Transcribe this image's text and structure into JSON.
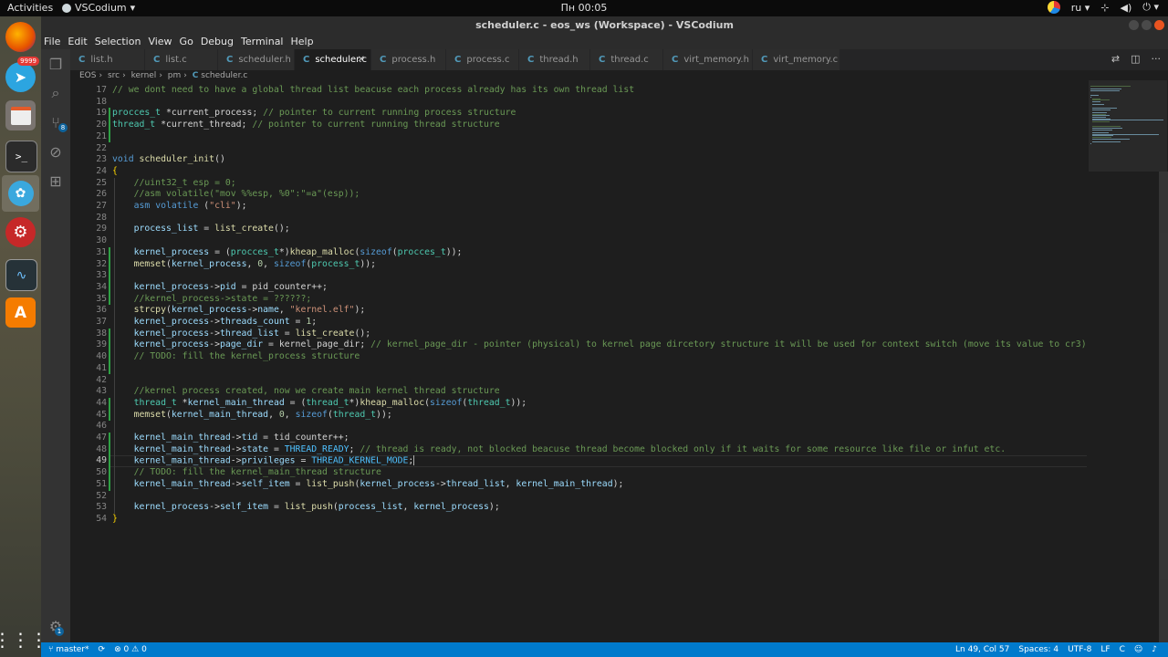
{
  "topbar": {
    "activities": "Activities",
    "app_name": "VSCodium",
    "clock": "Пн 00:05",
    "keyboard_layout": "ru"
  },
  "dock": {
    "telegram_badge": "9999"
  },
  "window": {
    "title": "scheduler.c - eos_ws (Workspace) - VSCodium"
  },
  "menu": [
    "File",
    "Edit",
    "Selection",
    "View",
    "Go",
    "Debug",
    "Terminal",
    "Help"
  ],
  "activity_bar": {
    "scm_badge": "8",
    "manage_badge": "1"
  },
  "tabs": [
    {
      "label": "list.h",
      "active": false
    },
    {
      "label": "list.c",
      "active": false
    },
    {
      "label": "scheduler.h",
      "active": false
    },
    {
      "label": "scheduler.c",
      "active": true
    },
    {
      "label": "process.h",
      "active": false
    },
    {
      "label": "process.c",
      "active": false
    },
    {
      "label": "thread.h",
      "active": false
    },
    {
      "label": "thread.c",
      "active": false
    },
    {
      "label": "virt_memory.h",
      "active": false
    },
    {
      "label": "virt_memory.c",
      "active": false
    }
  ],
  "breadcrumb": [
    "EOS",
    "src",
    "kernel",
    "pm",
    "scheduler.c"
  ],
  "editor": {
    "language": "c",
    "current_line": 49,
    "lines": [
      {
        "n": 17,
        "t": "// we dont need to have a global thread list beacuse each process already has its own thread list"
      },
      {
        "n": 18,
        "t": ""
      },
      {
        "n": 19,
        "t": "procces_t *current_process; // pointer to current running process structure"
      },
      {
        "n": 20,
        "t": "thread_t *current_thread; // pointer to current running thread structure"
      },
      {
        "n": 21,
        "t": ""
      },
      {
        "n": 22,
        "t": ""
      },
      {
        "n": 23,
        "t": "void scheduler_init()"
      },
      {
        "n": 24,
        "t": "{"
      },
      {
        "n": 25,
        "t": "    //uint32_t esp = 0;"
      },
      {
        "n": 26,
        "t": "    //asm volatile(\"mov %%esp, %0\":\"=a\"(esp));"
      },
      {
        "n": 27,
        "t": "    asm volatile (\"cli\");"
      },
      {
        "n": 28,
        "t": ""
      },
      {
        "n": 29,
        "t": "    process_list = list_create();"
      },
      {
        "n": 30,
        "t": ""
      },
      {
        "n": 31,
        "t": "    kernel_process = (procces_t*)kheap_malloc(sizeof(procces_t));"
      },
      {
        "n": 32,
        "t": "    memset(kernel_process, 0, sizeof(process_t));"
      },
      {
        "n": 33,
        "t": ""
      },
      {
        "n": 34,
        "t": "    kernel_process->pid = pid_counter++;"
      },
      {
        "n": 35,
        "t": "    //kernel_process->state = ??????;"
      },
      {
        "n": 36,
        "t": "    strcpy(kernel_process->name, \"kernel.elf\");"
      },
      {
        "n": 37,
        "t": "    kernel_process->threads_count = 1;"
      },
      {
        "n": 38,
        "t": "    kernel_process->thread_list = list_create();"
      },
      {
        "n": 39,
        "t": "    kernel_process->page_dir = kernel_page_dir; // kernel_page_dir - pointer (physical) to kernel page dircetory structure it will be used for context switch (move its value to cr3)"
      },
      {
        "n": 40,
        "t": "    // TODO: fill the kernel_process structure"
      },
      {
        "n": 41,
        "t": ""
      },
      {
        "n": 42,
        "t": ""
      },
      {
        "n": 43,
        "t": "    //kernel process created, now we create main kernel thread structure"
      },
      {
        "n": 44,
        "t": "    thread_t *kernel_main_thread = (thread_t*)kheap_malloc(sizeof(thread_t));"
      },
      {
        "n": 45,
        "t": "    memset(kernel_main_thread, 0, sizeof(thread_t));"
      },
      {
        "n": 46,
        "t": ""
      },
      {
        "n": 47,
        "t": "    kernel_main_thread->tid = tid_counter++;"
      },
      {
        "n": 48,
        "t": "    kernel_main_thread->state = THREAD_READY; // thread is ready, not blocked beacuse thread become blocked only if it waits for some resource like file or infut etc."
      },
      {
        "n": 49,
        "t": "    kernel_main_thread->privileges = THREAD_KERNEL_MODE;"
      },
      {
        "n": 50,
        "t": "    // TODO: fill the kernel_main_thread structure"
      },
      {
        "n": 51,
        "t": "    kernel_main_thread->self_item = list_push(kernel_process->thread_list, kernel_main_thread);"
      },
      {
        "n": 52,
        "t": ""
      },
      {
        "n": 53,
        "t": "    kernel_process->self_item = list_push(process_list, kernel_process);"
      },
      {
        "n": 54,
        "t": "}"
      }
    ]
  },
  "statusbar": {
    "branch": "master*",
    "problems": "0",
    "warnings": "0",
    "position": "Ln 49, Col 57",
    "spaces": "Spaces: 4",
    "encoding": "UTF-8",
    "eol": "LF",
    "language": "C"
  },
  "colors": {
    "statusbar": "#007acc",
    "editor_bg": "#1e1e1e",
    "comment": "#6a9955",
    "keyword": "#569cd6",
    "string": "#ce9178"
  },
  "icons": [
    "files-icon",
    "search-icon",
    "source-control-icon",
    "debug-icon",
    "extensions-icon",
    "manage-gear-icon",
    "split-editor-icon",
    "more-actions-icon",
    "git-branch-icon",
    "sync-icon",
    "error-icon",
    "warning-icon"
  ]
}
